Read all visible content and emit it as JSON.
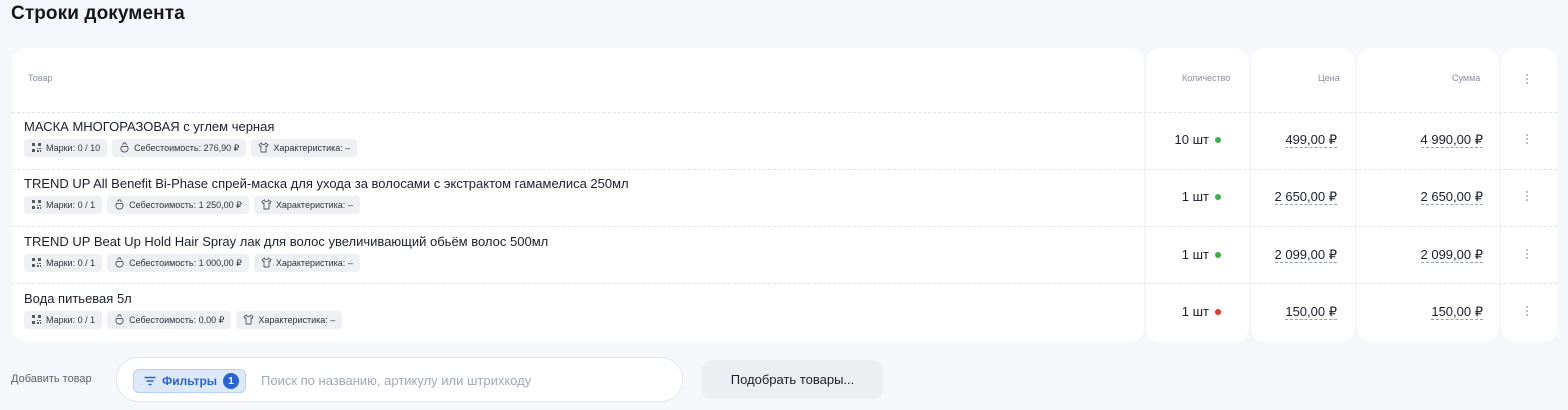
{
  "section": {
    "title": "Строки документа"
  },
  "table": {
    "headers": {
      "product": "Товар",
      "quantity": "Количество",
      "price": "Цена",
      "sum": "Сумма"
    },
    "rows": [
      {
        "name": "МАСКА МНОГОРАЗОВАЯ с углем черная",
        "marks": "Марки: 0 / 10",
        "cost": "Себестоимость: 276,90 ₽",
        "characteristic": "Характеристика: –",
        "quantity": "10 шт",
        "status": "green",
        "price": "499,00 ₽",
        "sum": "4 990,00 ₽"
      },
      {
        "name": "TREND UP All Benefit Bi-Phase спрей-маска для ухода за волосами с экстрактом гамамелиса 250мл",
        "marks": "Марки: 0 / 1",
        "cost": "Себестоимость: 1 250,00 ₽",
        "characteristic": "Характеристика: –",
        "quantity": "1 шт",
        "status": "green",
        "price": "2 650,00 ₽",
        "sum": "2 650,00 ₽"
      },
      {
        "name": "TREND UP Beat Up Hold Hair Spray лак для волос увеличивающий обьём волос 500мл",
        "marks": "Марки: 0 / 1",
        "cost": "Себестоимость: 1 000,00 ₽",
        "characteristic": "Характеристика: –",
        "quantity": "1 шт",
        "status": "green",
        "price": "2 099,00 ₽",
        "sum": "2 099,00 ₽"
      },
      {
        "name": "Вода питьевая 5л",
        "marks": "Марки: 0 / 1",
        "cost": "Себестоимость: 0.00 ₽",
        "characteristic": "Характеристика: –",
        "quantity": "1 шт",
        "status": "red",
        "price": "150,00 ₽",
        "sum": "150,00 ₽"
      }
    ]
  },
  "add_product": {
    "label": "Добавить товар",
    "filter_label": "Фильтры",
    "filter_count": "1",
    "search_placeholder": "Поиск по названию, артикулу или штрихкоду",
    "pick_button": "Подобрать товары..."
  },
  "colors": {
    "green": "#3cb043",
    "red": "#e5372a",
    "accent": "#2a63d4"
  }
}
